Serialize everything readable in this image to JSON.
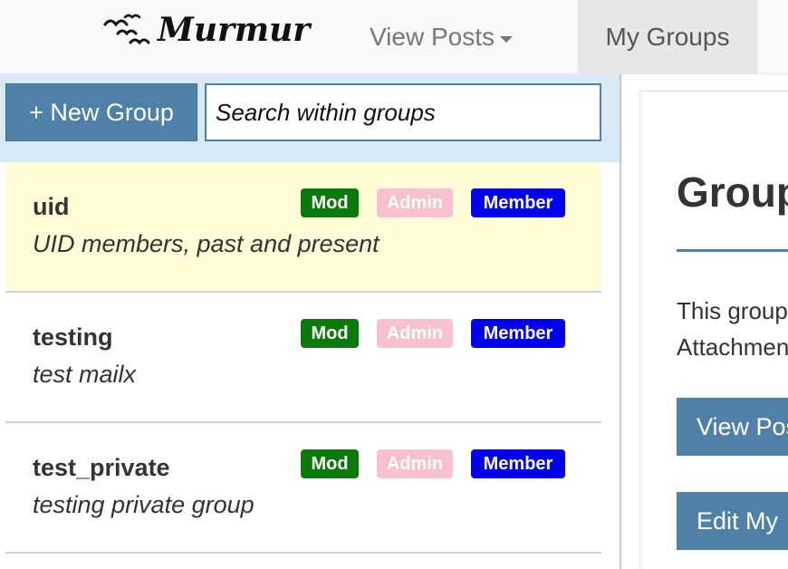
{
  "app": {
    "brand": "Murmur",
    "logo_icon": "birds-icon"
  },
  "navbar": {
    "view_posts_label": "View Posts",
    "my_groups_label": "My Groups"
  },
  "toolbar": {
    "new_group_label": "+ New Group",
    "search_placeholder": "Search within groups"
  },
  "badges": {
    "mod": "Mod",
    "admin": "Admin",
    "member": "Member"
  },
  "groups": [
    {
      "name": "uid",
      "description": "UID members, past and present",
      "active": true
    },
    {
      "name": "testing",
      "description": "test mailx",
      "active": false
    },
    {
      "name": "test_private",
      "description": "testing private group",
      "active": false
    }
  ],
  "detail": {
    "title": "Group",
    "text_line1": "This group",
    "text_line2": "Attachments",
    "view_posts_btn": "View Posts",
    "edit_btn": "Edit My"
  },
  "colors": {
    "accent": "#4f81a8",
    "mod_badge": "#0a7a0a",
    "admin_badge": "#f7c0cc",
    "member_badge": "#0000ee",
    "active_row": "#fefdd8",
    "toolbar_bg": "#d9eaf7"
  }
}
